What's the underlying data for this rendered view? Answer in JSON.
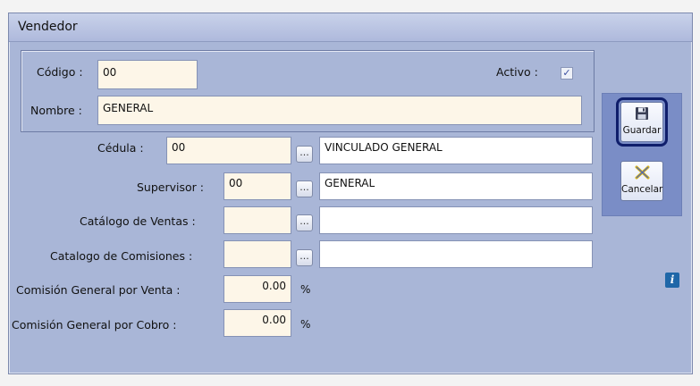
{
  "window": {
    "title": "Vendedor"
  },
  "form": {
    "codigo": {
      "label": "Código :",
      "value": "00"
    },
    "activo": {
      "label": "Activo :",
      "checked": true,
      "check_glyph": "✓"
    },
    "nombre": {
      "label": "Nombre :",
      "value": "GENERAL"
    },
    "cedula": {
      "label": "Cédula :",
      "value": "00",
      "lookup_button": "...",
      "description": "VINCULADO GENERAL"
    },
    "supervisor": {
      "label": "Supervisor :",
      "value": "00",
      "lookup_button": "...",
      "description": "GENERAL"
    },
    "catalogo_ventas": {
      "label": "Catálogo de Ventas :",
      "value": "",
      "lookup_button": "...",
      "description": ""
    },
    "catalogo_comisiones": {
      "label": "Catalogo de Comisiones :",
      "value": "",
      "lookup_button": "...",
      "description": ""
    },
    "comision_venta": {
      "label": "Comisión General por Venta :",
      "value": "0.00",
      "unit": "%"
    },
    "comision_cobro": {
      "label": "Comisión  General por Cobro :",
      "value": "0.00",
      "unit": "%"
    }
  },
  "toolbar": {
    "guardar": {
      "label": "Guardar",
      "icon": "floppy-disk-icon"
    },
    "cancelar": {
      "label": "Cancelar",
      "icon": "cross-icon"
    }
  },
  "info_icon": {
    "glyph": "i"
  },
  "colors": {
    "window_bg": "#a9b6d7",
    "field_bg": "#fdf6e8",
    "button_panel": "#7a8dc6",
    "focus": "#0f1e6b"
  }
}
